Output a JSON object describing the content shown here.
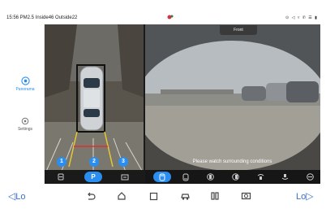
{
  "status_bar": {
    "text": "15:56  PM2.5 Inside46  Outside22",
    "icons": "⊙ ◁ ▿ ✆ ☰ ▮"
  },
  "sidebar": {
    "items": [
      {
        "label": "Panorama",
        "icon": "panorama-icon",
        "active": true
      },
      {
        "label": "Settings",
        "icon": "gear-icon",
        "active": false
      }
    ],
    "accent": "#2a8ef0"
  },
  "camera": {
    "front_label": "Front",
    "message": "Please watch surrounding conditions"
  },
  "markers": [
    "1",
    "2",
    "3"
  ],
  "left_toolbar": {
    "buttons": [
      {
        "name": "rear-view-button",
        "icon": "camera-rear-icon",
        "active": false
      },
      {
        "name": "parking-button",
        "label": "P",
        "icon": "parking-icon",
        "active": true
      },
      {
        "name": "3d-view-button",
        "icon": "view-3d-icon",
        "active": false
      }
    ]
  },
  "right_toolbar": {
    "buttons": [
      {
        "name": "front-view-button",
        "icon": "car-front-icon",
        "active": true
      },
      {
        "name": "rear-view-button",
        "icon": "car-rear-icon",
        "active": false
      },
      {
        "name": "left-view-button",
        "icon": "car-left-icon",
        "active": false
      },
      {
        "name": "right-view-button",
        "icon": "car-right-icon",
        "active": false
      },
      {
        "name": "front-wide-button",
        "icon": "wide-front-icon",
        "active": false
      },
      {
        "name": "rear-wide-button",
        "icon": "wide-rear-icon",
        "active": false
      },
      {
        "name": "side-view-button",
        "icon": "side-view-icon",
        "active": false
      }
    ]
  },
  "nav_bar": {
    "left_temp": "Lo",
    "right_temp": "Lo",
    "buttons": [
      "back-icon",
      "home-icon",
      "recents-icon",
      "car-icon",
      "sliders-icon",
      "camera-icon"
    ]
  }
}
